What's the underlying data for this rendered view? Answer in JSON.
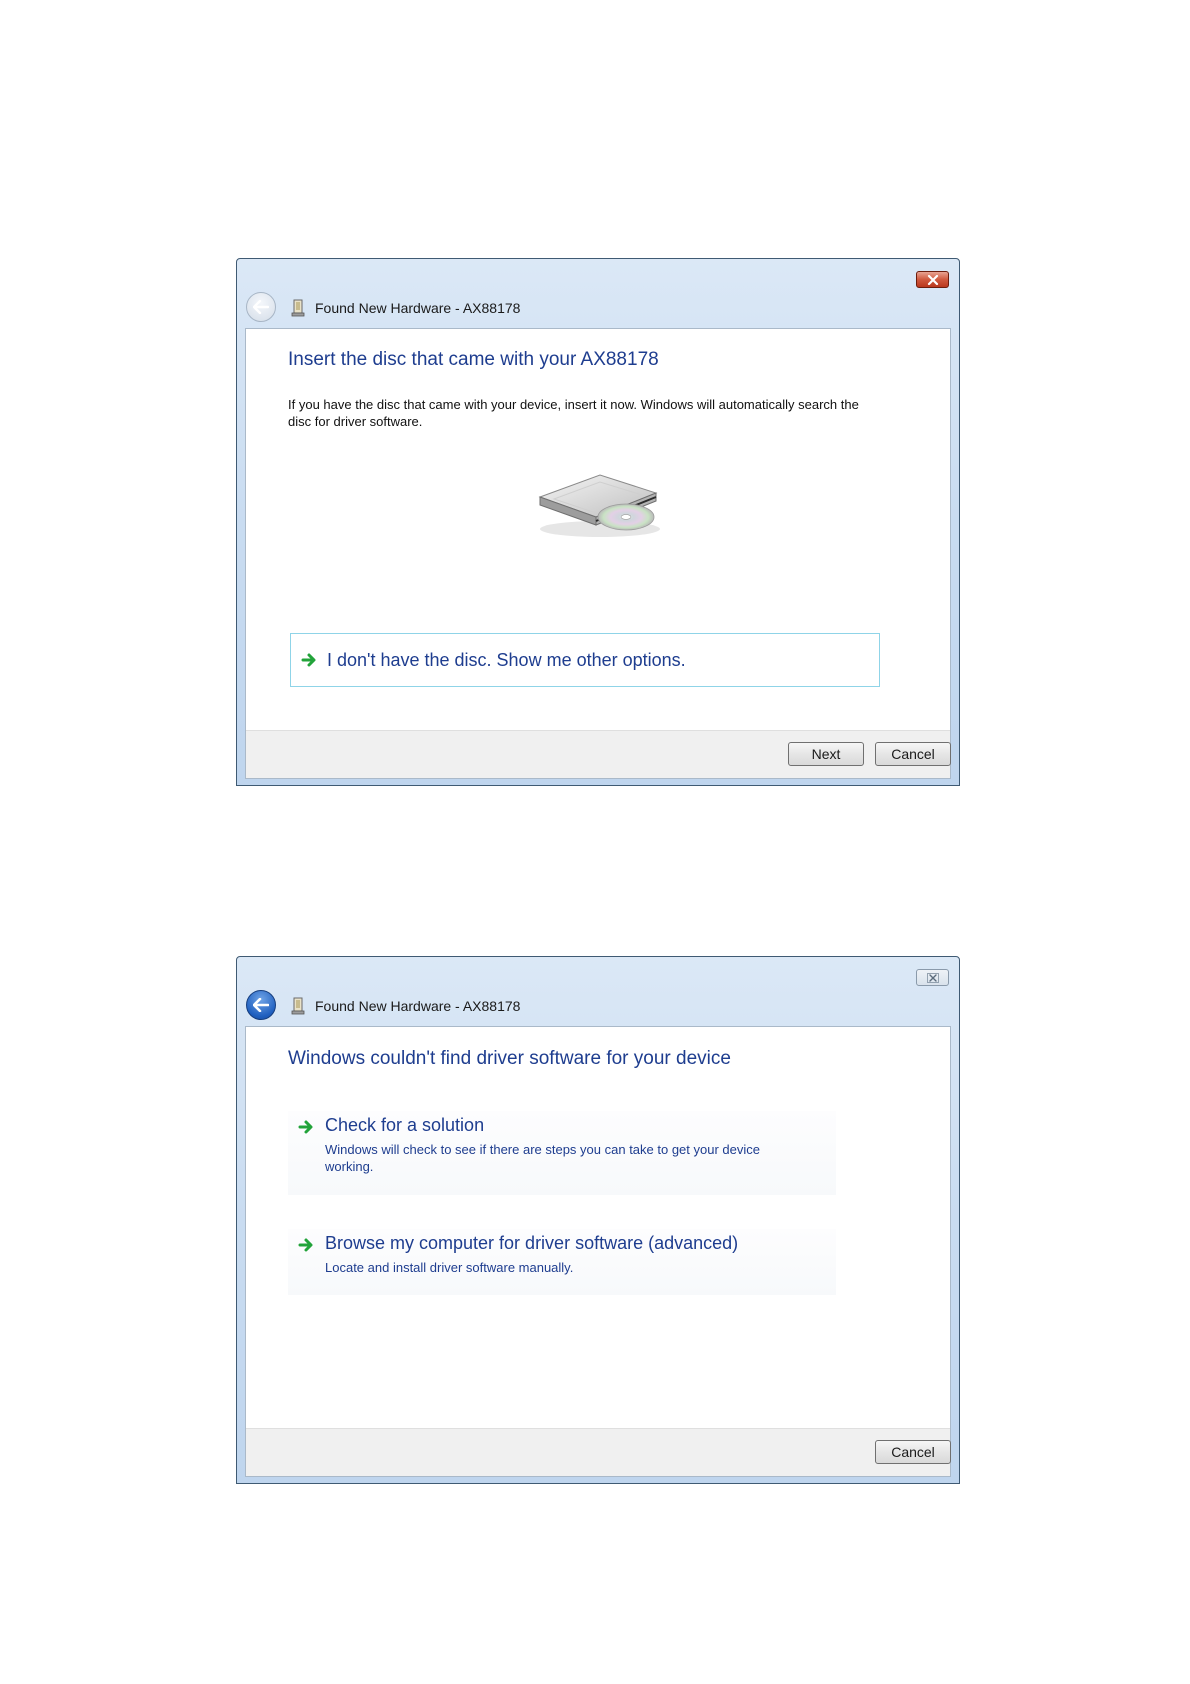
{
  "dialog1": {
    "title": "Found New Hardware - AX88178",
    "heading": "Insert the disc that came with your AX88178",
    "body": "If you have the disc that came with your device, insert it now.  Windows will automatically search the disc for driver software.",
    "option_label": "I don't have the disc.  Show me other options.",
    "next_label": "Next",
    "cancel_label": "Cancel"
  },
  "dialog2": {
    "title": "Found New Hardware - AX88178",
    "heading": "Windows couldn't find driver software for your device",
    "options": [
      {
        "title": "Check for a solution",
        "description": "Windows will check to see if there are steps you can take to get your device working."
      },
      {
        "title": "Browse my computer for driver software (advanced)",
        "description": "Locate and install driver software manually."
      }
    ],
    "cancel_label": "Cancel"
  },
  "icons": {
    "back": "back-arrow-icon",
    "hardware": "hardware-device-icon",
    "close": "close-icon",
    "option_arrow": "green-arrow-icon",
    "disc": "disc-drive-icon"
  },
  "colors": {
    "heading": "#1e3d8f",
    "arrow": "#22a33a",
    "close_active": "#c94a2f",
    "option_border": "#8fd4e8"
  }
}
